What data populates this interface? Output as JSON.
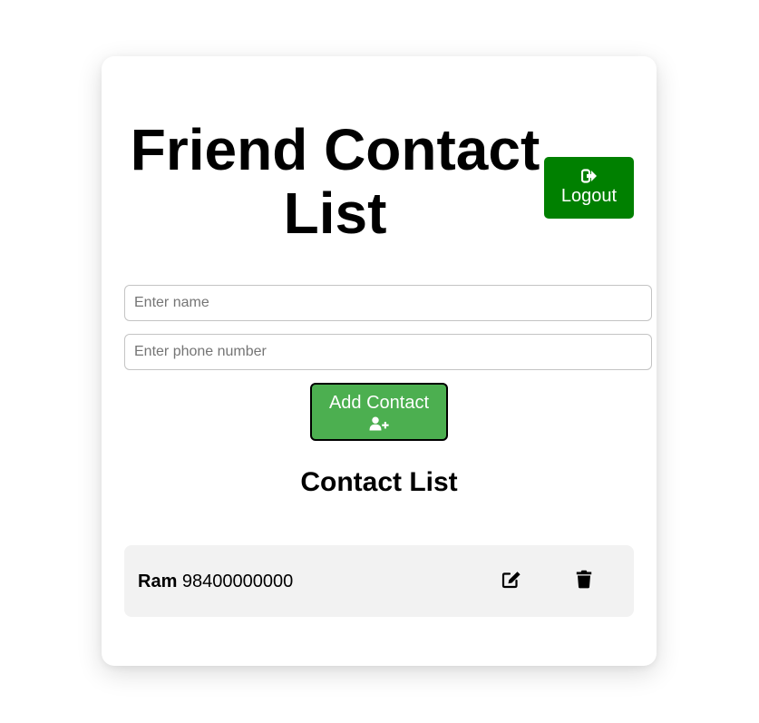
{
  "header": {
    "title": "Friend Contact List",
    "logout_label": "Logout",
    "logout_icon": "sign-out-icon",
    "logout_color": "#008000"
  },
  "form": {
    "name_placeholder": "Enter name",
    "name_value": "",
    "phone_placeholder": "Enter phone number",
    "phone_value": "",
    "add_label": "Add Contact",
    "add_icon": "user-plus-icon",
    "add_color": "#4caf50"
  },
  "contacts": {
    "heading": "Contact List",
    "items": [
      {
        "name": "Ram",
        "phone": "98400000000",
        "edit_icon": "edit-icon",
        "delete_icon": "trash-icon"
      }
    ]
  }
}
